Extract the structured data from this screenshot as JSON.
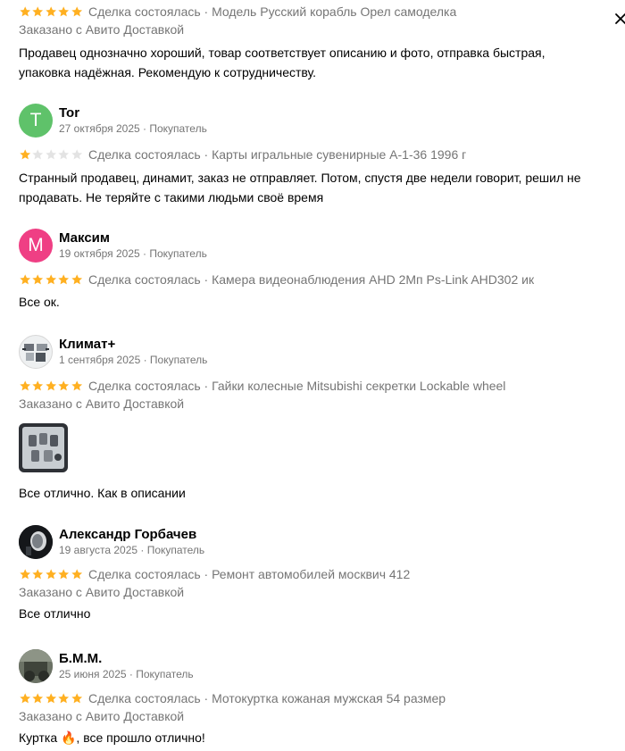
{
  "colors": {
    "star_filled": "#ffb021",
    "star_empty": "#e3e3e3",
    "meta_text": "#757575",
    "avatar_tor": "#5fc26a",
    "avatar_maksim": "#ef3f84"
  },
  "close": {
    "icon": "close-icon"
  },
  "reviews": [
    {
      "rating": 5,
      "deal": "Сделка состоялась · Модель Русский корабль Орел самоделка",
      "delivery": "Заказано с Авито Доставкой",
      "text": "Продавец однозначно хороший, товар соответствует описанию и фото, отправка быстрая, упаковка надёжная. Рекомендую к сотрудничеству."
    },
    {
      "avatar_letter": "T",
      "name": "Tor",
      "meta": "27 октября 2025 · Покупатель",
      "rating": 1,
      "deal": "Сделка состоялась · Карты игральные сувенирные А-1-36 1996 г",
      "text": "Странный продавец, динамит, заказ не отправляет. Потом, спустя две недели говорит, решил не продавать. Не теряйте с такими людьми своё время"
    },
    {
      "avatar_letter": "М",
      "name": "Максим",
      "meta": "19 октября 2025 · Покупатель",
      "rating": 5,
      "deal": "Сделка состоялась · Камера видеонаблюдения AHD 2Мп Ps-Link AHD302 ик",
      "text": "Все ок."
    },
    {
      "name": "Климат+",
      "meta": "1 сентября 2025 · Покупатель",
      "rating": 5,
      "deal": "Сделка состоялась · Гайки колесные Mitsubishi секретки Lockable wheel",
      "delivery": "Заказано с Авито Доставкой",
      "text": "Все отлично. Как в описании"
    },
    {
      "name": "Александр Горбачев",
      "meta": "19 августа 2025 · Покупатель",
      "rating": 5,
      "deal": "Сделка состоялась · Ремонт автомобилей москвич 412",
      "delivery": "Заказано с Авито Доставкой",
      "text": "Все отлично"
    },
    {
      "name": "Б.М.М.",
      "meta": "25 июня 2025 · Покупатель",
      "rating": 5,
      "deal": "Сделка состоялась · Мотокуртка кожаная мужская 54 размер",
      "delivery": "Заказано с Авито Доставкой",
      "text": "Куртка 🔥, все прошло отлично!"
    }
  ]
}
